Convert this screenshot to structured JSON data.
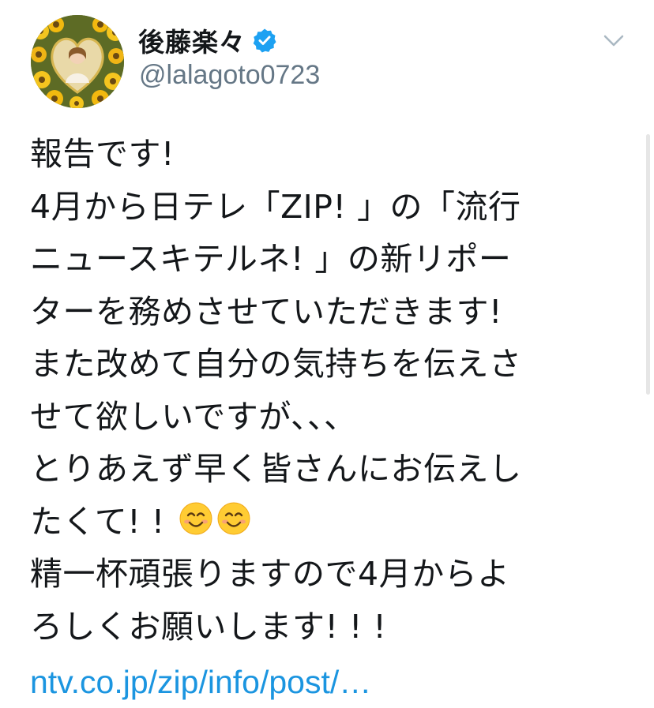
{
  "user": {
    "display_name": "後藤楽々",
    "handle": "@lalagoto0723",
    "verified": true,
    "avatar_icon": "profile-photo-sunflowers"
  },
  "tweet": {
    "lines": [
      "報告です!",
      "4月から日テレ「ZIP! 」の「流行",
      "ニュースキテルネ! 」の新リポー",
      "ターを務めさせていただきます!",
      "また改めて自分の気持ちを伝えさ",
      "せて欲しいですが、、、",
      "とりあえず早く皆さんにお伝えし",
      "たくて! ! ",
      "精一杯頑張りますので4月からよ",
      "ろしくお願いします! ! !"
    ],
    "emoji_line_icons": [
      "smiling-face-emoji",
      "smiling-face-emoji"
    ],
    "link": "ntv.co.jp/zip/info/post/…"
  },
  "icons": {
    "verified_badge": "verified-badge-icon",
    "menu": "chevron-down-icon"
  },
  "colors": {
    "text": "#14171a",
    "handle": "#657786",
    "link": "#1b95e0",
    "verified": "#1da1f2"
  }
}
